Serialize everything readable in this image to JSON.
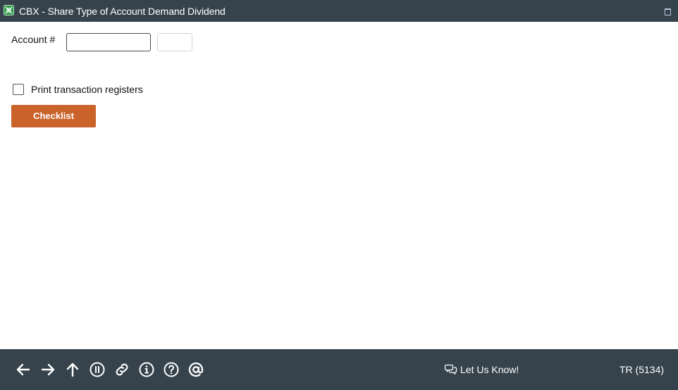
{
  "window": {
    "title": "CBX - Share Type of Account Demand Dividend",
    "app_icon": "cbx-logo-icon",
    "maximize_icon": "maximize-icon"
  },
  "form": {
    "account_label": "Account #",
    "account_value": "",
    "account_suffix_value": "",
    "print_registers_label": "Print transaction registers",
    "print_registers_checked": false,
    "checklist_button": "Checklist"
  },
  "footer": {
    "nav_icons": [
      "back-arrow-icon",
      "forward-arrow-icon",
      "up-arrow-icon",
      "pause-icon",
      "link-icon",
      "info-icon",
      "help-icon",
      "at-sign-icon"
    ],
    "feedback_label": "Let Us Know!",
    "screen_code": "TR (5134)"
  },
  "colors": {
    "titlebar": "#36434d",
    "footer": "#36434d",
    "accent_button": "#c9632a"
  }
}
